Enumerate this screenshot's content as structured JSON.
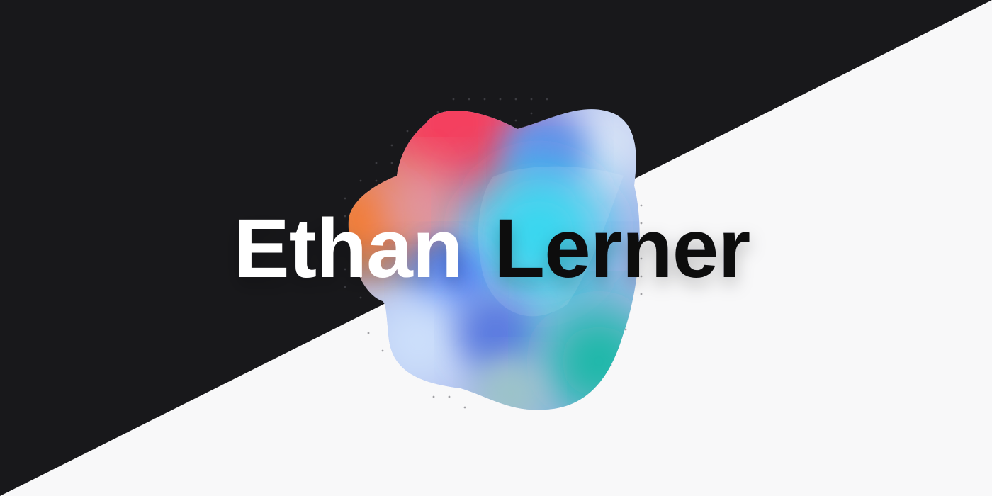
{
  "hero": {
    "first_name": "Ethan",
    "last_name": "Lerner"
  },
  "colors": {
    "dark_background": "#18181b",
    "light_background": "#f8f8f9",
    "first_name_color": "#ffffff",
    "last_name_color": "#09090b",
    "blob_red": "#f43f5e",
    "blob_orange": "#f97316",
    "blob_cyan": "#22d3ee",
    "blob_blue": "#6a8de8",
    "blob_teal": "#14b8a6"
  }
}
